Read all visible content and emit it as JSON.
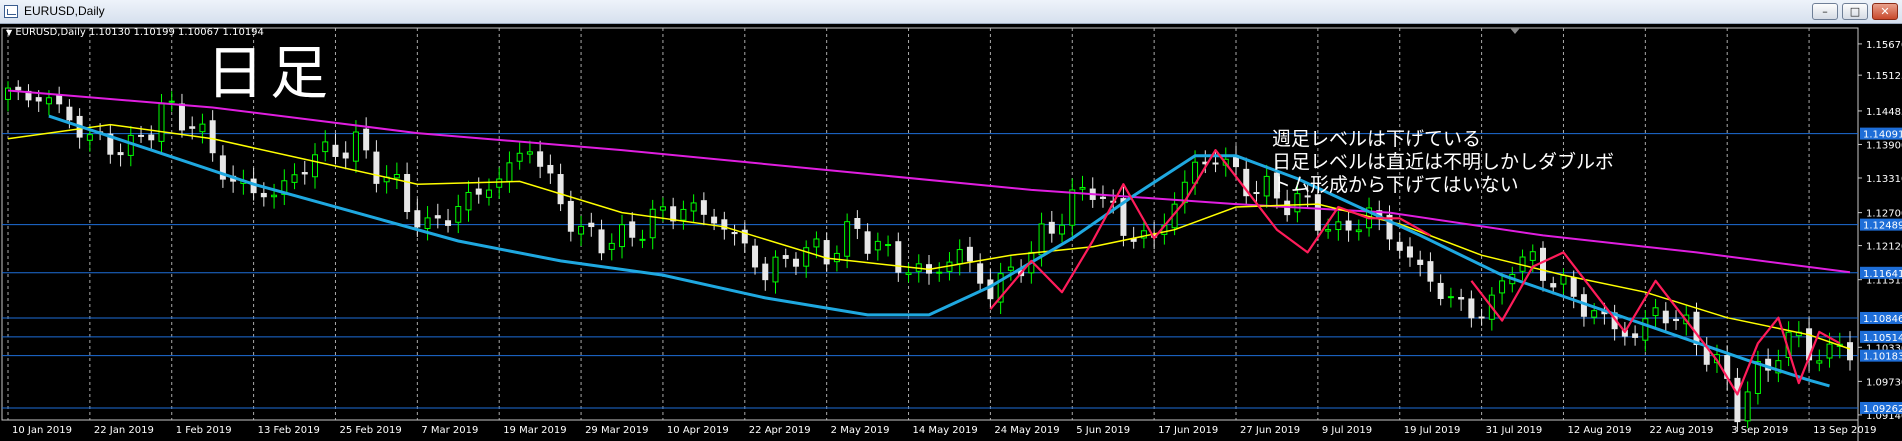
{
  "window": {
    "title": "EURUSD,Daily",
    "buttons": {
      "minimize": "–",
      "restore": "□",
      "close": "✕"
    }
  },
  "header": {
    "info": "EURUSD,Daily  1.10130 1.10199 1.10067 1.10194"
  },
  "annotation": {
    "big_label": "日足",
    "note_lines": [
      "週足レベルは下げている",
      "日足レベルは直近は不明しかしダブルボ",
      "トム形成から下げてはいない"
    ]
  },
  "colors": {
    "background": "#000000",
    "grid": "#c8c8c8",
    "bull": "#00ff00",
    "bear": "#e8e8e8",
    "ma_fast": "#ffff00",
    "ma_mid": "#1fa8e0",
    "ma_slow": "#e01ee0",
    "zigzag": "#ff1c5a",
    "level_line": "#1e6ed8",
    "level_box": "#1e6ed8"
  },
  "chart_data": {
    "type": "line",
    "series_type": "candlestick",
    "ylim": [
      1.0905,
      1.1595
    ],
    "y_ticks": [
      1.1567,
      1.1512,
      1.1449,
      1.139,
      1.1331,
      1.127,
      1.1212,
      1.1152,
      1.1033,
      1.0973,
      1.0914
    ],
    "y_tick_labels": [
      "1.15670",
      "1.15125",
      "1.14485",
      "1.13900",
      "1.13310",
      "1.12700",
      "1.12120",
      "1.11515",
      "1.10330",
      "1.09730",
      "1.09140"
    ],
    "price_levels": [
      {
        "value": 1.14091,
        "label": "1.14091"
      },
      {
        "value": 1.12489,
        "label": "1.12489"
      },
      {
        "value": 1.11641,
        "label": "1.11641"
      },
      {
        "value": 1.10846,
        "label": "1.10846"
      },
      {
        "value": 1.10514,
        "label": "1.10514"
      },
      {
        "value": 1.10183,
        "label": "1.10183"
      },
      {
        "value": 1.09262,
        "label": "1.09262"
      }
    ],
    "x_tick_labels": [
      {
        "i": 0,
        "label": "10 Jan 2019"
      },
      {
        "i": 8,
        "label": "22 Jan 2019"
      },
      {
        "i": 16,
        "label": "1 Feb 2019"
      },
      {
        "i": 24,
        "label": "13 Feb 2019"
      },
      {
        "i": 32,
        "label": "25 Feb 2019"
      },
      {
        "i": 40,
        "label": "7 Mar 2019"
      },
      {
        "i": 48,
        "label": "19 Mar 2019"
      },
      {
        "i": 56,
        "label": "29 Mar 2019"
      },
      {
        "i": 64,
        "label": "10 Apr 2019"
      },
      {
        "i": 72,
        "label": "22 Apr 2019"
      },
      {
        "i": 80,
        "label": "2 May 2019"
      },
      {
        "i": 88,
        "label": "14 May 2019"
      },
      {
        "i": 96,
        "label": "24 May 2019"
      },
      {
        "i": 104,
        "label": "5 Jun 2019"
      },
      {
        "i": 112,
        "label": "17 Jun 2019"
      },
      {
        "i": 120,
        "label": "27 Jun 2019"
      },
      {
        "i": 128,
        "label": "9 Jul 2019"
      },
      {
        "i": 136,
        "label": "19 Jul 2019"
      },
      {
        "i": 144,
        "label": "31 Jul 2019"
      },
      {
        "i": 152,
        "label": "12 Aug 2019"
      },
      {
        "i": 160,
        "label": "22 Aug 2019"
      },
      {
        "i": 168,
        "label": "3 Sep 2019"
      },
      {
        "i": 176,
        "label": "13 Sep 2019"
      }
    ],
    "bars_total": 181,
    "close_anchors": [
      [
        0,
        1.148
      ],
      [
        4,
        1.147
      ],
      [
        8,
        1.14
      ],
      [
        12,
        1.138
      ],
      [
        15,
        1.145
      ],
      [
        18,
        1.143
      ],
      [
        22,
        1.132
      ],
      [
        26,
        1.13
      ],
      [
        30,
        1.137
      ],
      [
        34,
        1.139
      ],
      [
        38,
        1.131
      ],
      [
        41,
        1.124
      ],
      [
        44,
        1.128
      ],
      [
        48,
        1.133
      ],
      [
        51,
        1.139
      ],
      [
        53,
        1.132
      ],
      [
        56,
        1.123
      ],
      [
        60,
        1.122
      ],
      [
        63,
        1.126
      ],
      [
        66,
        1.128
      ],
      [
        69,
        1.126
      ],
      [
        72,
        1.121
      ],
      [
        74,
        1.116
      ],
      [
        77,
        1.12
      ],
      [
        80,
        1.12
      ],
      [
        83,
        1.124
      ],
      [
        87,
        1.118
      ],
      [
        90,
        1.116
      ],
      [
        93,
        1.12
      ],
      [
        96,
        1.113
      ],
      [
        100,
        1.12
      ],
      [
        103,
        1.127
      ],
      [
        106,
        1.132
      ],
      [
        109,
        1.124
      ],
      [
        112,
        1.122
      ],
      [
        114,
        1.129
      ],
      [
        116,
        1.135
      ],
      [
        118,
        1.137
      ],
      [
        121,
        1.132
      ],
      [
        124,
        1.13
      ],
      [
        127,
        1.128
      ],
      [
        130,
        1.123
      ],
      [
        133,
        1.127
      ],
      [
        136,
        1.121
      ],
      [
        139,
        1.115
      ],
      [
        142,
        1.11
      ],
      [
        145,
        1.11
      ],
      [
        147,
        1.119
      ],
      [
        150,
        1.117
      ],
      [
        153,
        1.112
      ],
      [
        156,
        1.108
      ],
      [
        159,
        1.105
      ],
      [
        161,
        1.11
      ],
      [
        164,
        1.107
      ],
      [
        167,
        1.1
      ],
      [
        169,
        1.093
      ],
      [
        171,
        1.098
      ],
      [
        173,
        1.103
      ],
      [
        175,
        1.105
      ],
      [
        177,
        1.101
      ],
      [
        179,
        1.104
      ],
      [
        180,
        1.1019
      ]
    ],
    "ma_fast": [
      [
        0,
        1.14
      ],
      [
        10,
        1.1425
      ],
      [
        20,
        1.14
      ],
      [
        30,
        1.136
      ],
      [
        40,
        1.132
      ],
      [
        50,
        1.1325
      ],
      [
        60,
        1.127
      ],
      [
        70,
        1.1245
      ],
      [
        80,
        1.119
      ],
      [
        90,
        1.117
      ],
      [
        98,
        1.1195
      ],
      [
        106,
        1.121
      ],
      [
        114,
        1.124
      ],
      [
        120,
        1.128
      ],
      [
        128,
        1.1285
      ],
      [
        136,
        1.125
      ],
      [
        144,
        1.1195
      ],
      [
        152,
        1.116
      ],
      [
        160,
        1.113
      ],
      [
        168,
        1.1085
      ],
      [
        176,
        1.1055
      ],
      [
        180,
        1.103
      ]
    ],
    "ma_mid": [
      [
        4,
        1.144
      ],
      [
        14,
        1.138
      ],
      [
        24,
        1.132
      ],
      [
        34,
        1.127
      ],
      [
        44,
        1.122
      ],
      [
        54,
        1.1185
      ],
      [
        64,
        1.116
      ],
      [
        74,
        1.112
      ],
      [
        84,
        1.109
      ],
      [
        90,
        1.109
      ],
      [
        96,
        1.114
      ],
      [
        104,
        1.1225
      ],
      [
        110,
        1.13
      ],
      [
        116,
        1.137
      ],
      [
        120,
        1.137
      ],
      [
        126,
        1.133
      ],
      [
        132,
        1.128
      ],
      [
        138,
        1.123
      ],
      [
        146,
        1.116
      ],
      [
        154,
        1.111
      ],
      [
        162,
        1.106
      ],
      [
        170,
        1.101
      ],
      [
        176,
        1.0975
      ],
      [
        178,
        1.0965
      ]
    ],
    "ma_slow": [
      [
        0,
        1.1485
      ],
      [
        20,
        1.1455
      ],
      [
        40,
        1.141
      ],
      [
        60,
        1.138
      ],
      [
        80,
        1.1345
      ],
      [
        100,
        1.131
      ],
      [
        120,
        1.1285
      ],
      [
        135,
        1.127
      ],
      [
        150,
        1.123
      ],
      [
        165,
        1.12
      ],
      [
        180,
        1.1165
      ]
    ],
    "zigzag_segments": [
      [
        [
          96,
          1.11
        ],
        [
          100,
          1.1185
        ],
        [
          103,
          1.113
        ],
        [
          106,
          1.122
        ],
        [
          109,
          1.132
        ],
        [
          112,
          1.1225
        ],
        [
          115,
          1.129
        ],
        [
          118,
          1.138
        ],
        [
          121,
          1.131
        ],
        [
          124,
          1.124
        ],
        [
          127,
          1.12
        ],
        [
          130,
          1.128
        ],
        [
          133,
          1.126
        ],
        [
          136,
          1.126
        ],
        [
          139,
          1.123
        ]
      ],
      [
        [
          143,
          1.115
        ],
        [
          146,
          1.108
        ],
        [
          149,
          1.1175
        ],
        [
          152,
          1.12
        ],
        [
          155,
          1.113
        ],
        [
          158,
          1.106
        ],
        [
          161,
          1.115
        ],
        [
          164,
          1.108
        ],
        [
          167,
          1.101
        ],
        [
          169,
          1.095
        ],
        [
          171,
          1.104
        ],
        [
          173,
          1.1085
        ],
        [
          175,
          1.097
        ],
        [
          177,
          1.106
        ],
        [
          179,
          1.104
        ]
      ]
    ]
  }
}
